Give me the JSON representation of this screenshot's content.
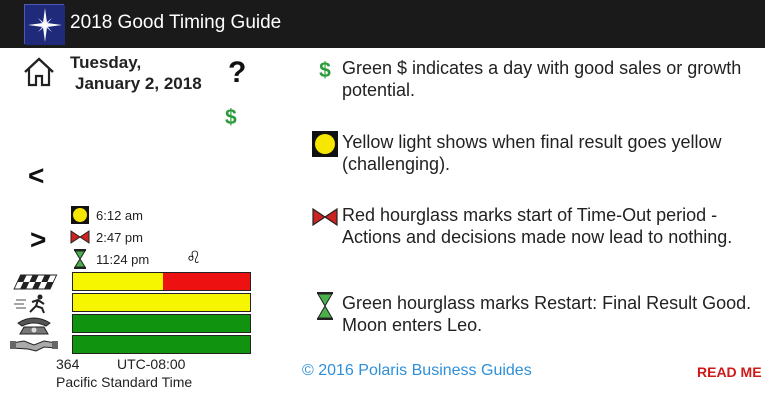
{
  "app": {
    "title": "2018 Good Timing Guide",
    "logo_icon": "polaris-star-icon"
  },
  "header": {
    "home_icon": "home-icon",
    "date_line1": "Tuesday,",
    "date_line2": "January 2, 2018",
    "help_label": "?",
    "sales_indicator": "$",
    "sales_indicator_color": "#2a9a3a"
  },
  "navigation": {
    "prev_label": "<",
    "next_label": ">"
  },
  "events": [
    {
      "icon": "yellow-light-icon",
      "time": "6:12 am"
    },
    {
      "icon": "red-hourglass-icon",
      "time": "2:47 pm"
    },
    {
      "icon": "green-hourglass-icon",
      "time": "11:24 pm"
    }
  ],
  "moon_sign_glyph": "♌",
  "timeline_bars": [
    {
      "category_icon": "checkered-flag-icon",
      "segments": [
        {
          "color": "#f6f600",
          "fraction": 0.51
        },
        {
          "color": "#ee1111",
          "fraction": 0.49
        }
      ]
    },
    {
      "category_icon": "running-person-icon",
      "segments": [
        {
          "color": "#f6f600",
          "fraction": 1.0
        }
      ]
    },
    {
      "category_icon": "telephone-icon",
      "segments": [
        {
          "color": "#109410",
          "fraction": 1.0
        }
      ]
    },
    {
      "category_icon": "handshake-icon",
      "segments": [
        {
          "color": "#109410",
          "fraction": 1.0
        }
      ]
    }
  ],
  "footer_info": {
    "day_number": "364",
    "utc_offset": "UTC-08:00",
    "timezone": "Pacific Standard Time"
  },
  "legend": [
    {
      "icon": "green-dollar-icon",
      "symbol": "$",
      "text": "Green $ indicates a day with good sales or growth potential."
    },
    {
      "icon": "yellow-light-icon",
      "text": "Yellow light shows when final result goes yellow (challenging)."
    },
    {
      "icon": "red-hourglass-icon",
      "text": "Red hourglass marks start of Time-Out period - Actions and decisions made now lead to nothing."
    },
    {
      "icon": "green-hourglass-icon",
      "text": "Green hourglass marks Restart: Final Result Good. Moon enters Leo."
    }
  ],
  "copyright": "© 2016 Polaris Business Guides",
  "readme_label": "READ ME",
  "colors": {
    "titlebar": "#1a1a1a",
    "link": "#2f8fd8",
    "readme": "#d01818",
    "yellow": "#f6f600",
    "red": "#ee1111",
    "green": "#109410"
  }
}
